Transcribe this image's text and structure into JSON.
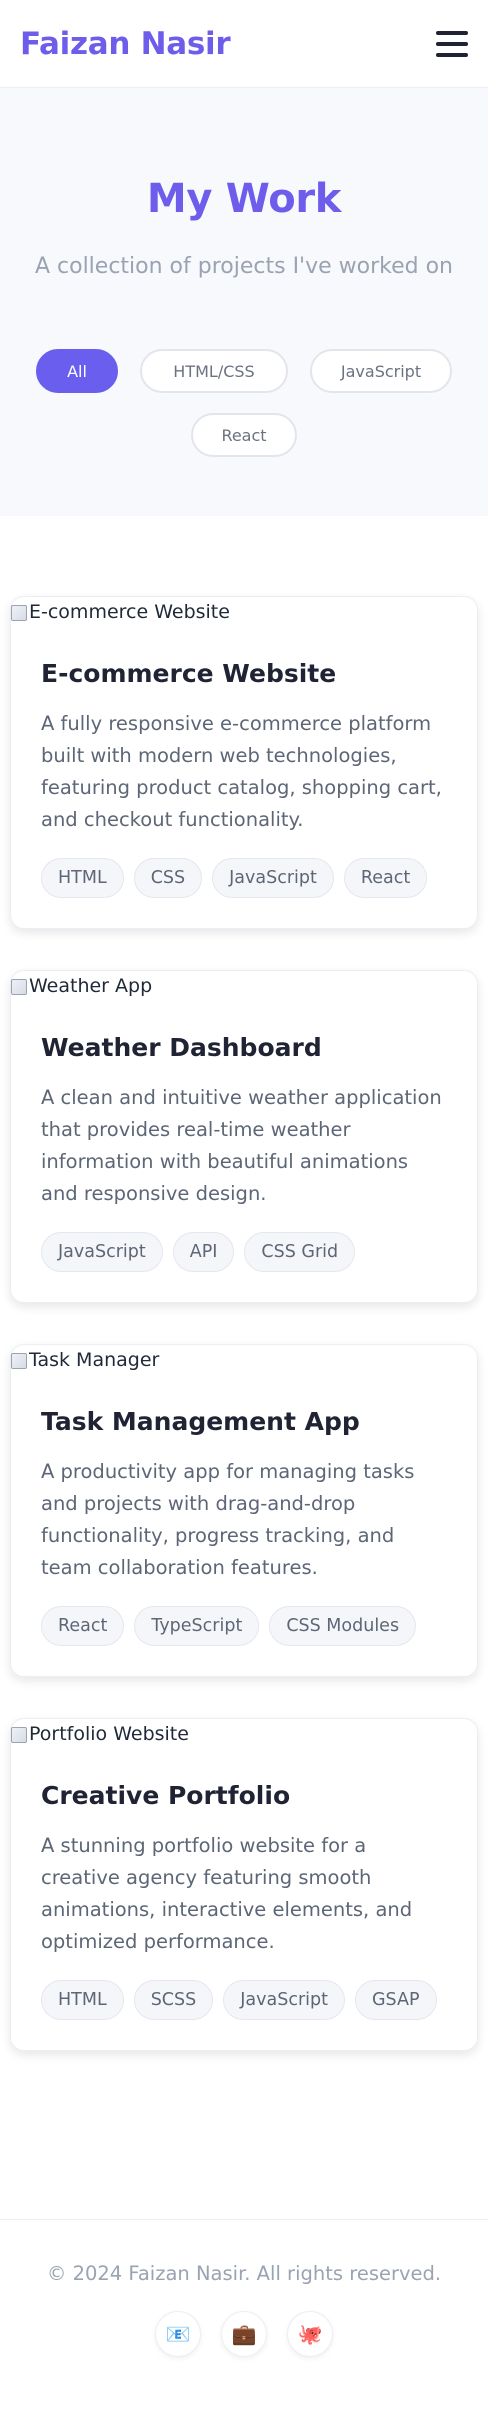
{
  "header": {
    "brand": "Faizan Nasir",
    "menu_icon": "hamburger-menu-icon"
  },
  "hero": {
    "title": "My Work",
    "subtitle": "A collection of projects I've worked on"
  },
  "filters": [
    {
      "label": "All",
      "active": true
    },
    {
      "label": "HTML/CSS",
      "active": false
    },
    {
      "label": "JavaScript",
      "active": false
    },
    {
      "label": "React",
      "active": false
    }
  ],
  "projects": [
    {
      "image_alt": "E-commerce Website",
      "title": "E-commerce Website",
      "description": "A fully responsive e-commerce platform built with modern web technologies, featuring product catalog, shopping cart, and checkout functionality.",
      "tags": [
        "HTML",
        "CSS",
        "JavaScript",
        "React"
      ]
    },
    {
      "image_alt": "Weather App",
      "title": "Weather Dashboard",
      "description": "A clean and intuitive weather application that provides real-time weather information with beautiful animations and responsive design.",
      "tags": [
        "JavaScript",
        "API",
        "CSS Grid"
      ]
    },
    {
      "image_alt": "Task Manager",
      "title": "Task Management App",
      "description": "A productivity app for managing tasks and projects with drag-and-drop functionality, progress tracking, and team collaboration features.",
      "tags": [
        "React",
        "TypeScript",
        "CSS Modules"
      ]
    },
    {
      "image_alt": "Portfolio Website",
      "title": "Creative Portfolio",
      "description": "A stunning portfolio website for a creative agency featuring smooth animations, interactive elements, and optimized performance.",
      "tags": [
        "HTML",
        "SCSS",
        "JavaScript",
        "GSAP"
      ]
    }
  ],
  "footer": {
    "copyright": "© 2024 Faizan Nasir. All rights reserved.",
    "social": [
      {
        "icon": "email-icon",
        "glyph": "📧"
      },
      {
        "icon": "briefcase-icon",
        "glyph": "💼"
      },
      {
        "icon": "octopus-icon",
        "glyph": "🐙"
      }
    ]
  },
  "colors": {
    "accent": "#6d5dea",
    "active_filter": "#6a5eee",
    "hero_bg": "#f8f9fc"
  }
}
